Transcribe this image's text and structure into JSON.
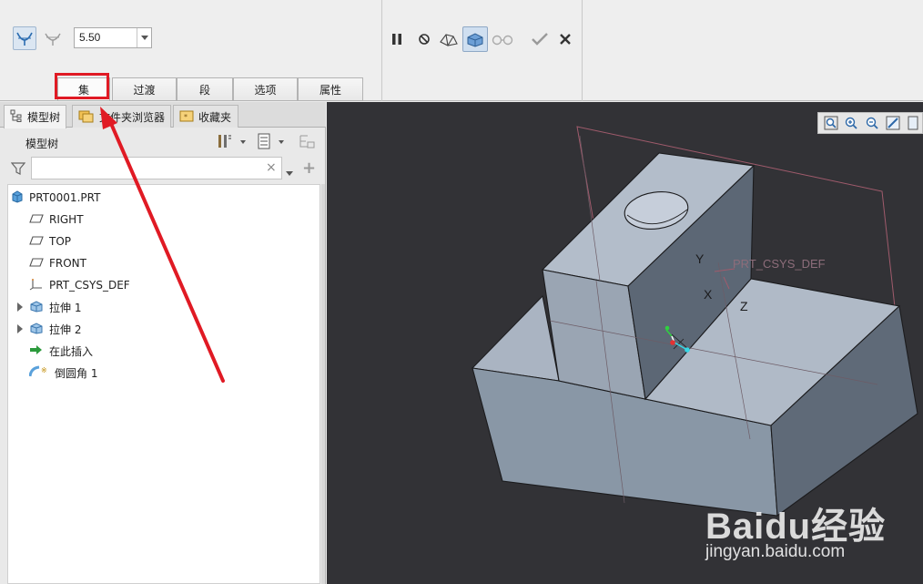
{
  "ribbon": {
    "radius_value": "5.50",
    "tabs": {
      "set": "集",
      "transition": "过渡",
      "segment": "段",
      "options": "选项",
      "properties": "属性"
    }
  },
  "panel": {
    "tabs": {
      "model_tree": "模型树",
      "folder_browser": "文件夹浏览器",
      "favorites": "收藏夹"
    },
    "tree_title": "模型树",
    "filter_value": "",
    "tree_items": [
      {
        "label": "PRT0001.PRT"
      },
      {
        "label": "RIGHT"
      },
      {
        "label": "TOP"
      },
      {
        "label": "FRONT"
      },
      {
        "label": "PRT_CSYS_DEF"
      },
      {
        "label": "拉伸 1"
      },
      {
        "label": "拉伸 2"
      },
      {
        "label": "在此插入"
      },
      {
        "label": "倒圆角 1"
      }
    ]
  },
  "viewport": {
    "csys_label": "PRT_CSYS_DEF",
    "axis_x": "X",
    "axis_y": "Y",
    "axis_z": "Z"
  },
  "watermark": {
    "brand": "Baidu经验",
    "url": "jingyan.baidu.com"
  },
  "colors": {
    "highlight_red": "#e01a24",
    "viewport_bg": "#323236",
    "model_face": "#8f9ba9"
  }
}
